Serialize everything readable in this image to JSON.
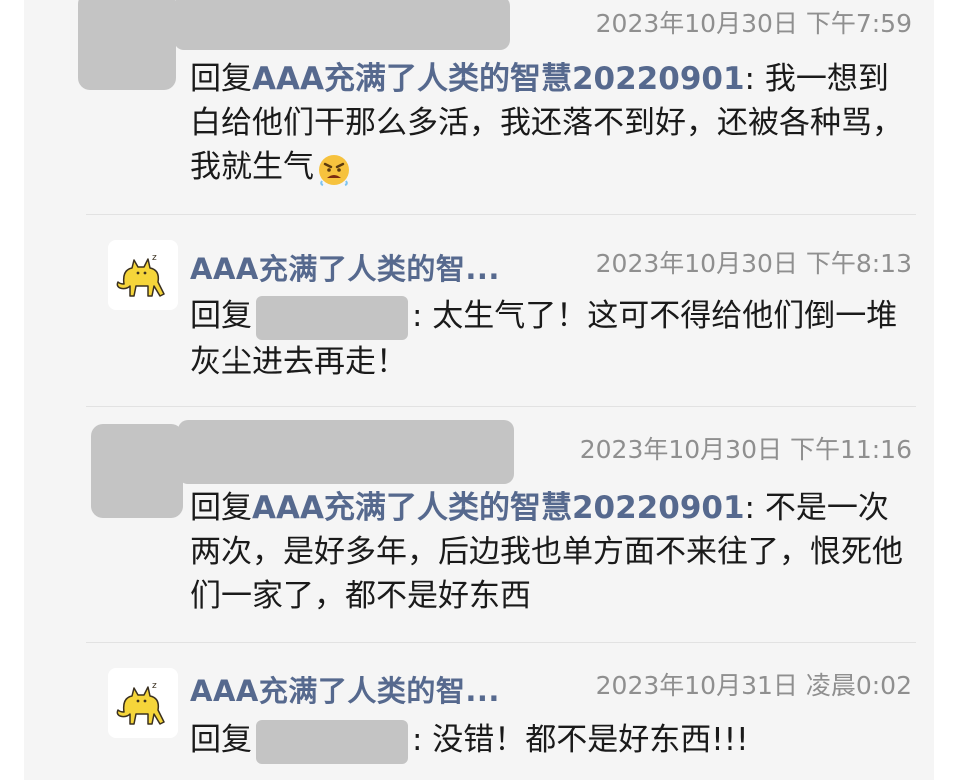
{
  "comments": [
    {
      "author": "",
      "timestamp": "2023年10月30日 下午7:59",
      "reply_prefix": "回复",
      "reply_target": "AAA充满了人类的智慧20220901",
      "text": ": 我一想到白给他们干那么多活，我还落不到好，还被各种骂，我就生气",
      "emoji": "angry-face"
    },
    {
      "author": "AAA充满了人类的智...",
      "timestamp": "2023年10月30日 下午8:13",
      "reply_prefix": "回复",
      "reply_target": "",
      "text": ": 太生气了！这可不得给他们倒一堆灰尘进去再走！"
    },
    {
      "author": "",
      "timestamp": "2023年10月30日 下午11:16",
      "reply_prefix": "回复",
      "reply_target": "AAA充满了人类的智慧20220901",
      "text": ": 不是一次两次，是好多年，后边我也单方面不来往了，恨死他们一家了，都不是好东西"
    },
    {
      "author": "AAA充满了人类的智...",
      "timestamp": "2023年10月31日 凌晨0:02",
      "reply_prefix": "回复",
      "reply_target": "",
      "text": ": 没错！都不是好东西!!!"
    }
  ],
  "colors": {
    "name": "#56698e",
    "timestamp": "#8f8f8f",
    "text": "#1a1a1a",
    "background": "#f5f5f5",
    "redacted": "#c4c4c4"
  }
}
